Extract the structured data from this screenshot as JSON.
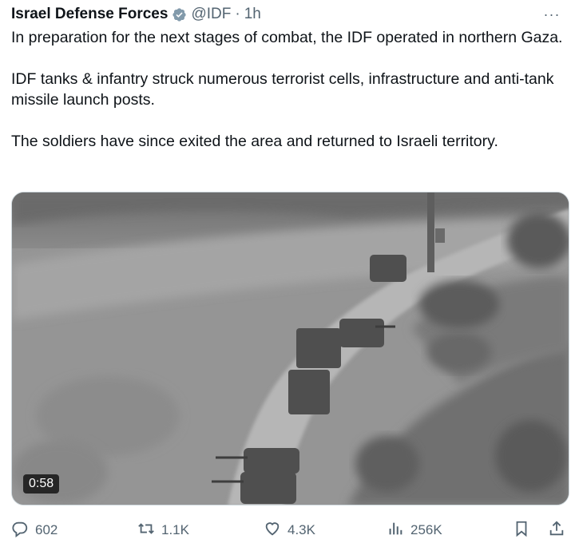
{
  "author": {
    "name": "Israel Defense Forces",
    "handle": "@IDF",
    "separator": "·",
    "time": "1h",
    "verified_icon": "verified-badge-icon"
  },
  "more_label": "···",
  "tweet": {
    "paragraphs": [
      "In preparation for the next stages of combat, the IDF operated in northern Gaza.",
      "IDF tanks & infantry struck numerous terrorist cells, infrastructure and anti-tank missile launch posts.",
      "The soldiers have since exited the area and returned to Israeli territory."
    ]
  },
  "media": {
    "duration": "0:58"
  },
  "actions": {
    "reply": "602",
    "retweet": "1.1K",
    "like": "4.3K",
    "views": "256K"
  },
  "colors": {
    "text": "#0f1419",
    "secondary": "#536471",
    "verified_badge": "#829aab"
  }
}
